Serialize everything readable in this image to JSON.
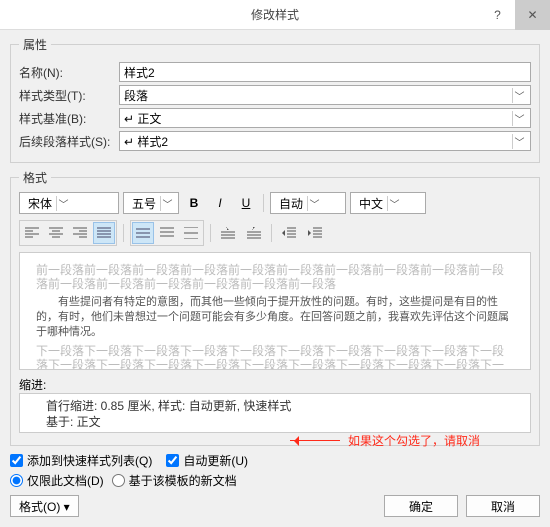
{
  "title": "修改样式",
  "sections": {
    "properties": "属性",
    "format": "格式",
    "indent": "缩进:"
  },
  "props": {
    "name_label": "名称(N):",
    "name_value": "样式2",
    "type_label": "样式类型(T):",
    "type_value": "段落",
    "base_label": "样式基准(B):",
    "base_value": "↵ 正文",
    "next_label": "后续段落样式(S):",
    "next_value": "↵ 样式2"
  },
  "fmt": {
    "font": "宋体",
    "size": "五号",
    "auto": "自动",
    "lang": "中文"
  },
  "preview": {
    "gray1": "前一段落前一段落前一段落前一段落前一段落前一段落前一段落前一段落前一段落前一段落前一段落前一段落前一段落前一段落前一段落前一段落",
    "sample": "有些提问者有特定的意图，而其他一些倾向于提开放性的问题。有时，这些提问是有目的性的，有时，他们未曾想过一个问题可能会有多少角度。在回答问题之前，我喜欢先评估这个问题属于哪种情况。",
    "gray2": "下一段落下一段落下一段落下一段落下一段落下一段落下一段落下一段落下一段落下一段落下一段落下一段落下一段落下一段落下一段落下一段落下一段落下一段落下一段落下一段落下一段落下一段落"
  },
  "desc": {
    "line1": "首行缩进:  0.85 厘米, 样式: 自动更新, 快速样式",
    "line2": "基于: 正文"
  },
  "checks": {
    "quicklist": "添加到快速样式列表(Q)",
    "autoupdate": "自动更新(U)",
    "doc_only": "仅限此文档(D)",
    "template": "基于该模板的新文档"
  },
  "footer": {
    "format_btn": "格式(O) ▾",
    "ok": "确定",
    "cancel": "取消"
  },
  "annotation": "如果这个勾选了，请取消",
  "icons": {
    "help": "?",
    "close": "✕",
    "dd": "﹀"
  }
}
